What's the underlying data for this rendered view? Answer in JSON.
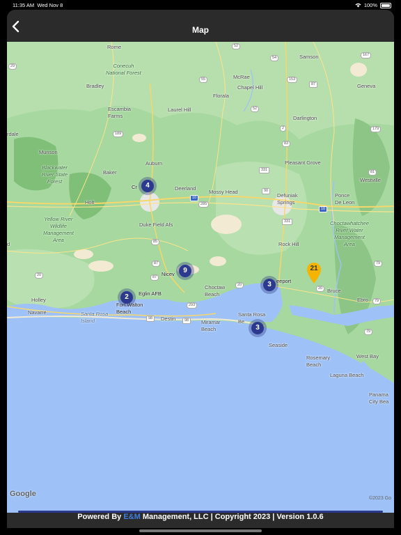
{
  "status": {
    "time": "11:35 AM",
    "date": "Wed Nov 8",
    "battery": "100%"
  },
  "nav": {
    "title": "Map",
    "back_icon": "chevron-left-icon"
  },
  "map": {
    "labels": {
      "rome": "Rome",
      "samson": "Samson",
      "geneva": "Geneva",
      "conecuh": "Conecuh\nNational Forest",
      "mcrae": "McRae",
      "florala": "Florala",
      "chapel_hill": "Chapel Hill",
      "bradley": "Bradley",
      "escambia": "Escambia\nFarms",
      "laurel_hill": "Laurel Hill",
      "darlington": "Darlington",
      "rdale": "rdale",
      "munson": "Munson",
      "blackwater": "Blackwater\nRiver State\nForest",
      "baker": "Baker",
      "auburn": "Auburn",
      "pleasant_grove": "Pleasant Grove",
      "westville": "Westville",
      "crestview": "Cr",
      "deerland": "Deerland",
      "mossy_head": "Mossy Head",
      "defuniak": "Defuniak\nSprings",
      "ponce": "Ponce\nDe Leon",
      "holt": "Holt",
      "yellow_river": "Yellow River\nWildlife\nManagement\nArea",
      "duke_field": "Duke Field Afs",
      "choctaw_mgmt": "Choctawhatchee\nRiver Water\nManagement\nArea",
      "rock_hill": "Rock Hill",
      "niceville": "Nicev",
      "freeport": "eeport",
      "bruce": "Bruce",
      "ebro": "Ebro",
      "holley": "Holley",
      "eglin": "Eglin AFB",
      "fort_walton": "Fort Walton\nBeach",
      "choctaw_beach": "Choctaw\nBeach",
      "santa_rosa": "Santa Rosa\nBe",
      "navarre": "Navarre",
      "santa_rosa_island": "Santa Rosa\nIsland",
      "destin": "Destin",
      "miramar": "Miramar\nBeach",
      "seaside": "Seaside",
      "rosemary": "Rosemary\nBeach",
      "west_bay": "West Bay",
      "laguna": "Laguna Beach",
      "panama": "Panama\nCity Bea",
      "d_left": "d"
    },
    "shields": [
      "29",
      "52",
      "54",
      "55",
      "153",
      "87",
      "167",
      "52",
      "2",
      "179",
      "189",
      "83",
      "331",
      "81",
      "90",
      "10",
      "285",
      "85",
      "10",
      "331",
      "79",
      "20",
      "20",
      "79",
      "293",
      "98",
      "98",
      "20",
      "79",
      "87",
      "87",
      "331",
      "4",
      "2",
      "10",
      "4",
      "98",
      "77"
    ],
    "clusters": [
      {
        "count": "4",
        "name": "crestview"
      },
      {
        "count": "9",
        "name": "niceville"
      },
      {
        "count": "2",
        "name": "fort-walton"
      },
      {
        "count": "3",
        "name": "freeport"
      },
      {
        "count": "3",
        "name": "santa-rosa"
      }
    ],
    "pin": {
      "count": "21",
      "color": "#f4b400"
    },
    "attribution": "Google",
    "copyright": "©2023 Go"
  },
  "footer": {
    "prefix": "Powered By ",
    "brand_e": "E&M",
    "suffix": " Management, LLC | Copyright 2023 | Version 1.0.6"
  },
  "colors": {
    "land": "#a6d8a0",
    "water": "#9ec2f7",
    "cluster": "#2b3a8f",
    "pin": "#f4b400",
    "panel": "#2b2b2b"
  }
}
